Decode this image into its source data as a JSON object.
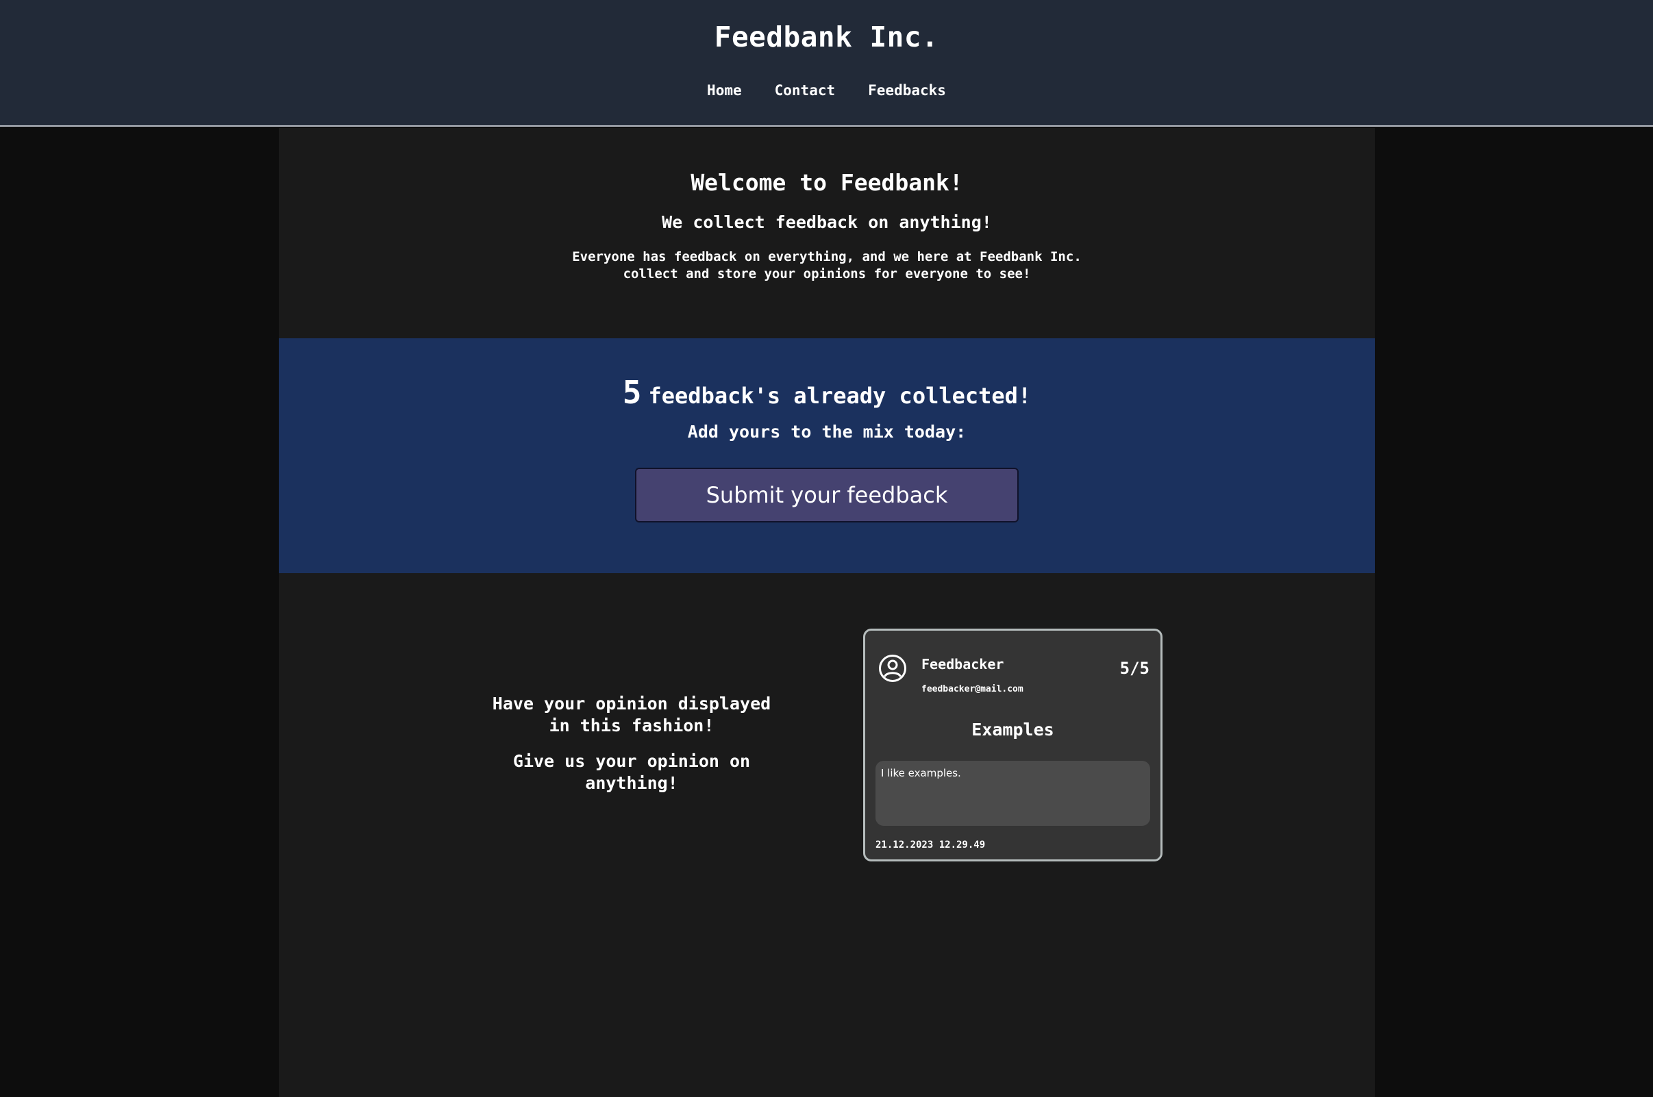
{
  "header": {
    "brand": "Feedbank Inc.",
    "nav": {
      "home": "Home",
      "contact": "Contact",
      "feedbacks": "Feedbacks"
    }
  },
  "intro": {
    "title": "Welcome to Feedbank!",
    "subtitle": "We collect feedback on anything!",
    "description": "Everyone has feedback on everything, and we here at Feedbank Inc. collect and store your opinions for everyone to see!"
  },
  "stats": {
    "count": "5",
    "count_label": "feedback's already collected!",
    "cta_text": "Add yours to the mix today:",
    "submit_label": "Submit your feedback"
  },
  "pitch": {
    "line1": "Have your opinion displayed in this fashion!",
    "line2": "Give us your opinion on anything!"
  },
  "example_card": {
    "author": "Feedbacker",
    "email": "feedbacker@mail.com",
    "rating": "5/5",
    "title": "Examples",
    "body": "I like examples.",
    "date": "21.12.2023 12.29.49",
    "avatar_icon": "user-circle-icon"
  },
  "colors": {
    "header_bg": "#222a38",
    "page_bg": "#0d0d0d",
    "content_bg": "#1a1a1a",
    "band_bg": "#1b315e",
    "button_bg": "#454270",
    "card_bg": "#343434",
    "card_body_bg": "#4b4b4b"
  }
}
